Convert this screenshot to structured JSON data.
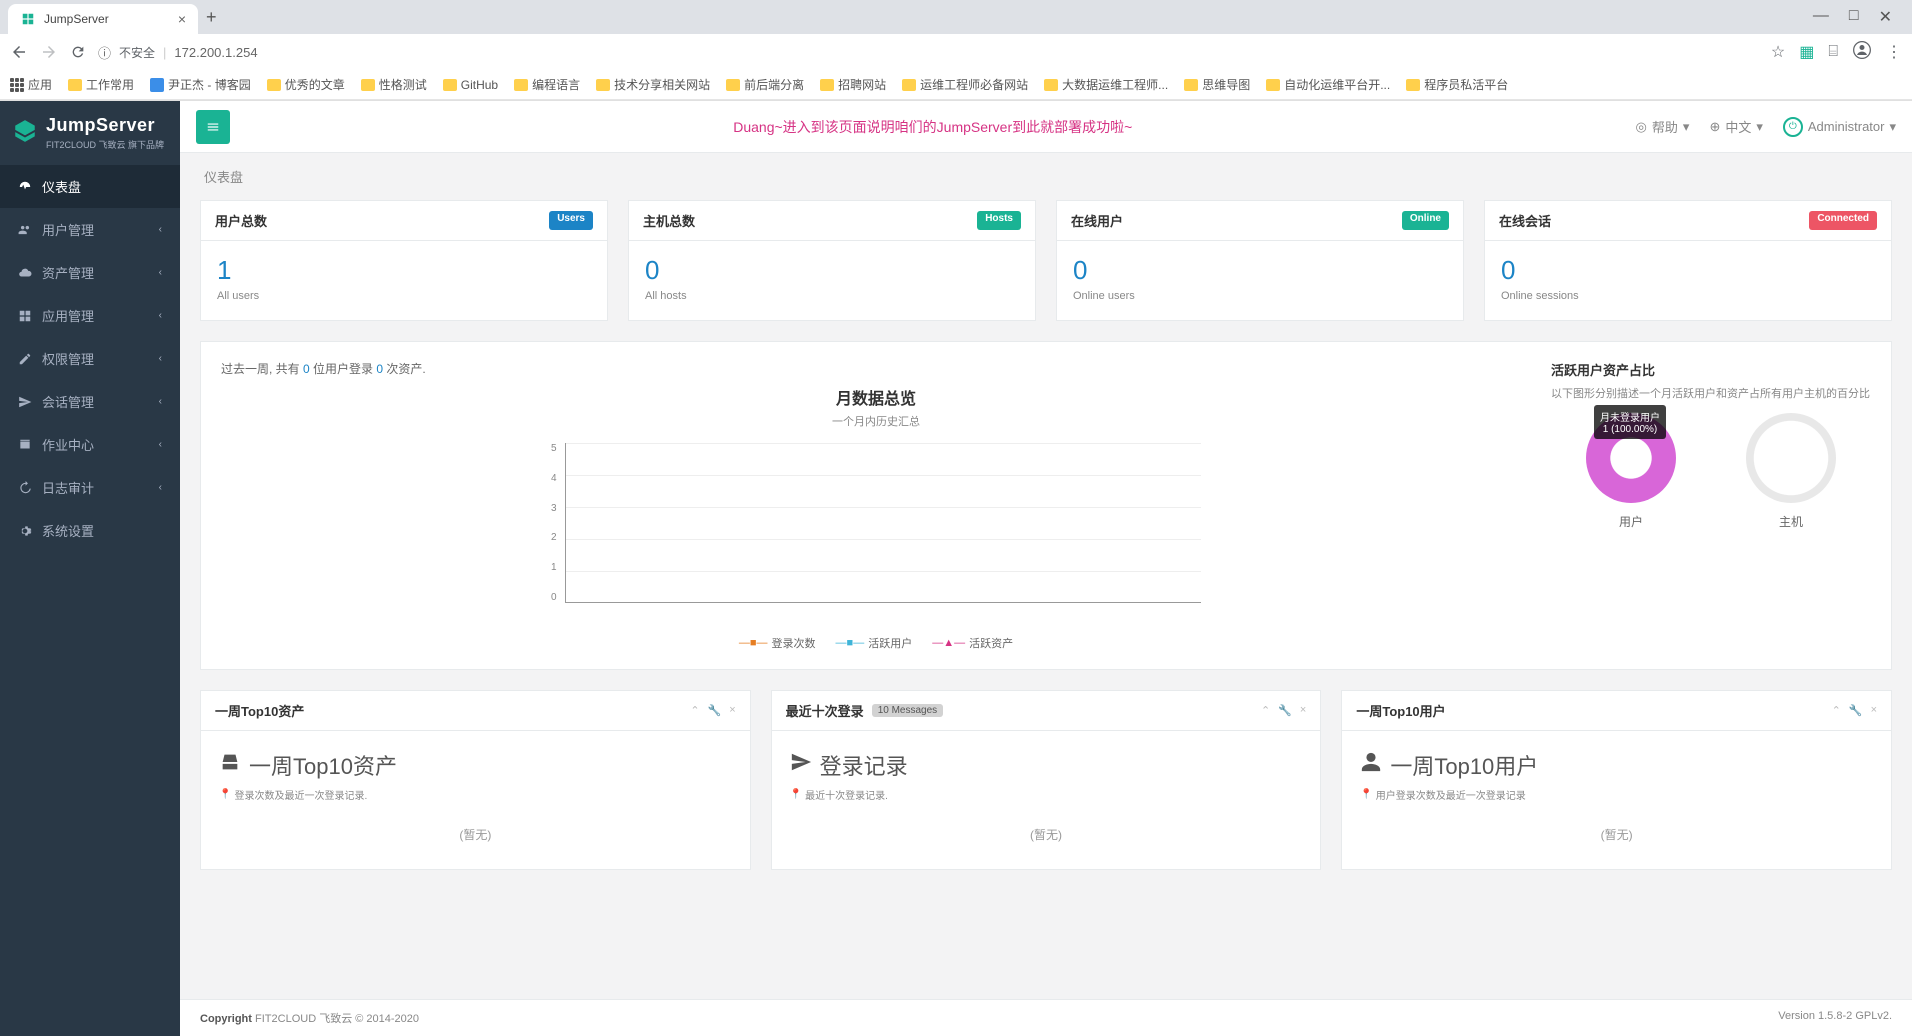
{
  "browser": {
    "tab_title": "JumpServer",
    "url": "172.200.1.254",
    "security": "不安全",
    "bookmarks": [
      "应用",
      "工作常用",
      "尹正杰 - 博客园",
      "优秀的文章",
      "性格测试",
      "GitHub",
      "编程语言",
      "技术分享相关网站",
      "前后端分离",
      "招聘网站",
      "运维工程师必备网站",
      "大数据运维工程师...",
      "思维导图",
      "自动化运维平台开...",
      "程序员私活平台"
    ]
  },
  "app_name": "JumpServer",
  "app_subtitle": "FIT2CLOUD 飞致云 旗下品牌",
  "banner": "Duang~进入到该页面说明咱们的JumpServer到此就部署成功啦~",
  "topbar": {
    "help": "帮助",
    "lang": "中文",
    "user": "Administrator"
  },
  "breadcrumb": "仪表盘",
  "sidebar": {
    "items": [
      {
        "label": "仪表盘",
        "icon": "dashboard",
        "active": true,
        "has_children": false
      },
      {
        "label": "用户管理",
        "icon": "users",
        "active": false,
        "has_children": true
      },
      {
        "label": "资产管理",
        "icon": "cloud",
        "active": false,
        "has_children": true
      },
      {
        "label": "应用管理",
        "icon": "grid",
        "active": false,
        "has_children": true
      },
      {
        "label": "权限管理",
        "icon": "edit",
        "active": false,
        "has_children": true
      },
      {
        "label": "会话管理",
        "icon": "send",
        "active": false,
        "has_children": true
      },
      {
        "label": "作业中心",
        "icon": "book",
        "active": false,
        "has_children": true
      },
      {
        "label": "日志审计",
        "icon": "history",
        "active": false,
        "has_children": true
      },
      {
        "label": "系统设置",
        "icon": "gears",
        "active": false,
        "has_children": false
      }
    ]
  },
  "stats": [
    {
      "title": "用户总数",
      "badge": "Users",
      "badge_class": "badge-info",
      "value": "1",
      "sub": "All users"
    },
    {
      "title": "主机总数",
      "badge": "Hosts",
      "badge_class": "badge-primary",
      "value": "0",
      "sub": "All hosts"
    },
    {
      "title": "在线用户",
      "badge": "Online",
      "badge_class": "badge-success",
      "value": "0",
      "sub": "Online users"
    },
    {
      "title": "在线会话",
      "badge": "Connected",
      "badge_class": "badge-danger",
      "value": "0",
      "sub": "Online sessions"
    }
  ],
  "week_stat": {
    "prefix": "过去一周, 共有 ",
    "users": "0",
    "mid": " 位用户登录 ",
    "assets": "0",
    "suffix": " 次资产."
  },
  "chart_data": {
    "type": "line",
    "title": "月数据总览",
    "subtitle": "一个月内历史汇总",
    "ylim": [
      0,
      5
    ],
    "y_ticks": [
      0,
      1,
      2,
      3,
      4,
      5
    ],
    "series": [
      {
        "name": "登录次数",
        "color": "#e67e22",
        "values": []
      },
      {
        "name": "活跃用户",
        "color": "#3fb4d8",
        "values": []
      },
      {
        "name": "活跃资产",
        "color": "#d63384",
        "values": []
      }
    ]
  },
  "donut_section": {
    "title": "活跃用户资产占比",
    "subtitle": "以下图形分别描述一个月活跃用户和资产占所有用户主机的百分比",
    "tooltip_line1": "月未登录用户",
    "tooltip_line2": "1 (100.00%)",
    "user_label": "用户",
    "host_label": "主机"
  },
  "bottom_cards": [
    {
      "title": "一周Top10资产",
      "heading": "一周Top10资产",
      "sub": "登录次数及最近一次登录记录.",
      "icon": "hdd",
      "badge": null,
      "empty": "(暂无)"
    },
    {
      "title": "最近十次登录",
      "heading": "登录记录",
      "sub": "最近十次登录记录.",
      "icon": "send",
      "badge": "10 Messages",
      "empty": "(暂无)"
    },
    {
      "title": "一周Top10用户",
      "heading": "一周Top10用户",
      "sub": "用户登录次数及最近一次登录记录",
      "icon": "user",
      "badge": null,
      "empty": "(暂无)"
    }
  ],
  "footer": {
    "copyright_label": "Copyright",
    "copyright": "FIT2CLOUD 飞致云 © 2014-2020",
    "version": "Version 1.5.8-2 GPLv2."
  }
}
